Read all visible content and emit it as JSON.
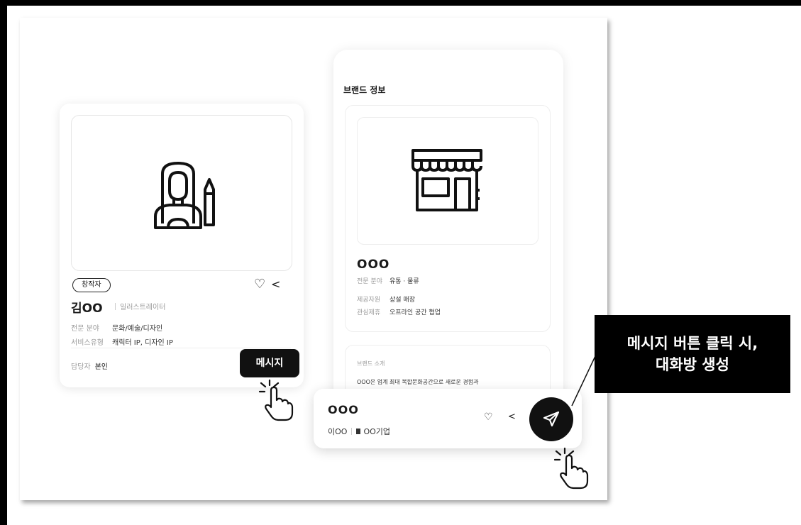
{
  "creator_card": {
    "tag": "창작자",
    "name": "김OO",
    "role": "일러스트레이터",
    "rows": [
      {
        "key": "전문 분야",
        "value": "문화/예술/디자인"
      },
      {
        "key": "서비스유형",
        "value": "캐릭터 IP, 디자인 IP"
      }
    ],
    "manager_key": "담당자",
    "manager_value": "본인",
    "message_button": "메시지",
    "image_icon": "female-creator-with-pencil-icon"
  },
  "brand_panel": {
    "title": "브랜드 정보",
    "name": "OOO",
    "rows": [
      {
        "key": "전문 분야",
        "value": "유통 · 물류"
      },
      {
        "key": "제공자원",
        "value": "상설 매장"
      },
      {
        "key": "관심제휴",
        "value": "오프라인 공간 협업"
      }
    ],
    "intro_label": "브랜드 소개",
    "intro_text": "OOO은 업계 최대 복합문화공간으로 새로운 경험과",
    "image_icon": "storefront-icon"
  },
  "chat_bar": {
    "name": "OOO",
    "person": "이OO",
    "company": "OO기업"
  },
  "annotation": {
    "line1": "메시지 버튼 클릭 시,",
    "line2": "대화방 생성"
  },
  "icons": {
    "like": "heart-icon",
    "share": "share-icon",
    "send": "paper-plane-icon",
    "pointer": "click-hand-icon"
  },
  "colors": {
    "button_bg": "#111111",
    "callout_bg": "#000000",
    "muted_text": "#9a9a9a"
  }
}
